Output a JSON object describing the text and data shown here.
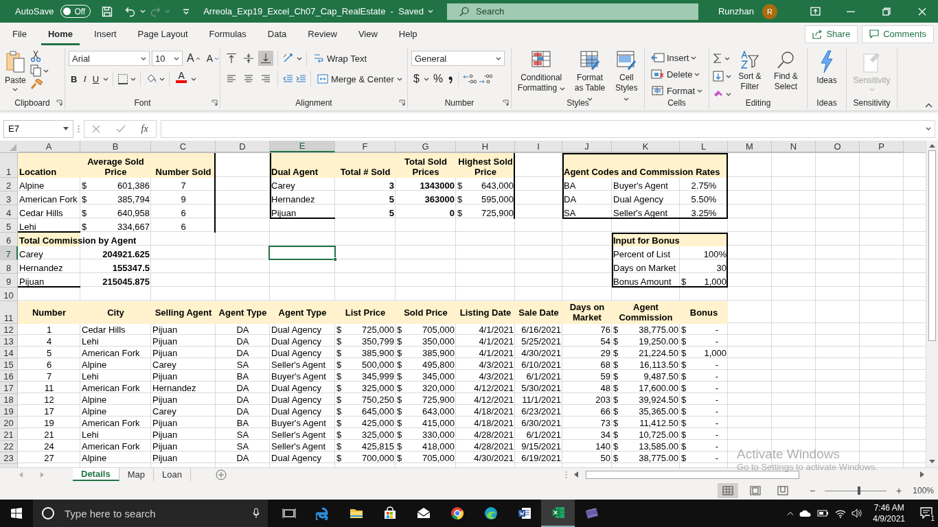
{
  "title_bar": {
    "autosave_label": "AutoSave",
    "autosave_on": false,
    "autosave_state": "Off",
    "document_title": "Arreola_Exp19_Excel_Ch07_Cap_RealEstate  -  Saved",
    "search_placeholder": "Search",
    "user_name": "Runzhan",
    "user_initial": "R"
  },
  "ribbon": {
    "tabs": [
      {
        "label": "File",
        "selected": false
      },
      {
        "label": "Home",
        "selected": true
      },
      {
        "label": "Insert",
        "selected": false
      },
      {
        "label": "Page Layout",
        "selected": false
      },
      {
        "label": "Formulas",
        "selected": false
      },
      {
        "label": "Data",
        "selected": false
      },
      {
        "label": "Review",
        "selected": false
      },
      {
        "label": "View",
        "selected": false
      },
      {
        "label": "Help",
        "selected": false
      }
    ],
    "share": "Share",
    "comments": "Comments",
    "groups": [
      {
        "kind": "clipboard",
        "label": "Clipboard",
        "paste": "Paste"
      },
      {
        "kind": "font",
        "label": "Font",
        "font_name": "Arial",
        "font_size": "10",
        "grow": "A",
        "shrink": "A",
        "bold": "B",
        "italic": "I",
        "underline": "U",
        "font_color": "A"
      },
      {
        "kind": "alignment",
        "label": "Alignment",
        "vertical_align": [
          {
            "selected": false
          },
          {
            "selected": false
          },
          {
            "selected": true
          }
        ],
        "horizontal_align": [
          {
            "selected": false
          },
          {
            "selected": false
          },
          {
            "selected": false
          }
        ],
        "wrap_text": "Wrap Text",
        "merge": "Merge & Center"
      },
      {
        "kind": "number",
        "label": "Number",
        "format": "General",
        "currency": "$",
        "percent": "%"
      },
      {
        "kind": "styles",
        "label": "Styles",
        "buttons": [
          "Conditional Formatting",
          "Format as Table",
          "Cell Styles"
        ]
      },
      {
        "kind": "cells",
        "label": "Cells",
        "buttons": [
          "Insert",
          "Delete",
          "Format"
        ]
      },
      {
        "kind": "editing",
        "label": "Editing",
        "buttons": [
          "Sort & Filter",
          "Find & Select"
        ]
      },
      {
        "kind": "ideas",
        "label": "Ideas",
        "button": "Ideas"
      },
      {
        "kind": "sensitivity",
        "label": "Sensitivity",
        "button": "Sensitivity",
        "disabled": true
      }
    ]
  },
  "formula_bar": {
    "name_box": "E7",
    "function_label": "fx"
  },
  "sheet": {
    "columns": [
      {
        "label": "A",
        "selected": false
      },
      {
        "label": "B",
        "selected": false
      },
      {
        "label": "C",
        "selected": false
      },
      {
        "label": "D",
        "selected": false
      },
      {
        "label": "E",
        "selected": true
      },
      {
        "label": "F",
        "selected": false
      },
      {
        "label": "G",
        "selected": false
      },
      {
        "label": "H",
        "selected": false
      },
      {
        "label": "I",
        "selected": false
      },
      {
        "label": "J",
        "selected": false
      },
      {
        "label": "K",
        "selected": false
      },
      {
        "label": "L",
        "selected": false
      },
      {
        "label": "M",
        "selected": false
      },
      {
        "label": "N",
        "selected": false
      },
      {
        "label": "O",
        "selected": false
      },
      {
        "label": "P",
        "selected": false
      }
    ],
    "rows": [
      {
        "label": "1",
        "selected": false,
        "kind": "tall",
        "cells": [
          {
            "kind": "heading-left",
            "text": "Location"
          },
          {
            "kind": "heading",
            "text": "Average Sold Price"
          },
          {
            "kind": "heading",
            "text": "Number Sold"
          },
          {
            "kind": "blank"
          },
          {
            "kind": "heading-left",
            "text": "Dual Agent"
          },
          {
            "kind": "heading",
            "text": "Total # Sold"
          },
          {
            "kind": "heading",
            "text": "Total Sold Prices"
          },
          {
            "kind": "heading",
            "text": "Highest Sold Price"
          },
          {
            "kind": "blank"
          },
          {
            "kind": "heading-left",
            "text": "Agent Codes and Commission Rates"
          },
          {
            "kind": "fill"
          },
          {
            "kind": "fill"
          }
        ]
      },
      {
        "label": "2",
        "selected": false,
        "kind": "normal",
        "cells": [
          {
            "kind": "text",
            "text": "Alpine"
          },
          {
            "kind": "money",
            "symbol": "$",
            "text": "601,386"
          },
          {
            "kind": "center",
            "text": "7"
          },
          {
            "kind": "blank"
          },
          {
            "kind": "text",
            "text": "Carey"
          },
          {
            "kind": "bold-num",
            "text": "3"
          },
          {
            "kind": "bold-num",
            "text": "1343000"
          },
          {
            "kind": "money",
            "symbol": "$",
            "text": "643,000"
          },
          {
            "kind": "blank"
          },
          {
            "kind": "text",
            "text": "BA"
          },
          {
            "kind": "text",
            "text": "Buyer's Agent"
          },
          {
            "kind": "center",
            "text": "2.75%"
          }
        ]
      },
      {
        "label": "3",
        "selected": false,
        "kind": "normal",
        "cells": [
          {
            "kind": "text",
            "text": "American Fork"
          },
          {
            "kind": "money",
            "symbol": "$",
            "text": "385,794"
          },
          {
            "kind": "center",
            "text": "9"
          },
          {
            "kind": "blank"
          },
          {
            "kind": "text",
            "text": "Hernandez"
          },
          {
            "kind": "bold-num",
            "text": "5"
          },
          {
            "kind": "bold-num",
            "text": "363000"
          },
          {
            "kind": "money",
            "symbol": "$",
            "text": "595,000"
          },
          {
            "kind": "blank"
          },
          {
            "kind": "text",
            "text": "DA"
          },
          {
            "kind": "text",
            "text": "Dual Agency"
          },
          {
            "kind": "center",
            "text": "5.50%"
          }
        ]
      },
      {
        "label": "4",
        "selected": false,
        "kind": "normal",
        "cells": [
          {
            "kind": "text",
            "text": "Cedar Hills"
          },
          {
            "kind": "money",
            "symbol": "$",
            "text": "640,958"
          },
          {
            "kind": "center",
            "text": "6"
          },
          {
            "kind": "blank"
          },
          {
            "kind": "text",
            "text": "Pijuan"
          },
          {
            "kind": "bold-num",
            "text": "5"
          },
          {
            "kind": "bold-num",
            "text": "0"
          },
          {
            "kind": "money",
            "symbol": "$",
            "text": "725,900"
          },
          {
            "kind": "blank"
          },
          {
            "kind": "text",
            "text": "SA"
          },
          {
            "kind": "text",
            "text": "Seller's Agent"
          },
          {
            "kind": "center",
            "text": "3.25%"
          }
        ]
      },
      {
        "label": "5",
        "selected": false,
        "kind": "normal",
        "cells": [
          {
            "kind": "text",
            "text": "Lehi"
          },
          {
            "kind": "money",
            "symbol": "$",
            "text": "334,667"
          },
          {
            "kind": "center",
            "text": "6"
          }
        ]
      },
      {
        "label": "6",
        "selected": false,
        "kind": "normal",
        "cells": [
          {
            "kind": "title",
            "text": "Total Commission by Agent"
          },
          {
            "kind": "blank"
          },
          {
            "kind": "blank"
          },
          {
            "kind": "blank"
          },
          {
            "kind": "blank"
          },
          {
            "kind": "blank"
          },
          {
            "kind": "blank"
          },
          {
            "kind": "blank"
          },
          {
            "kind": "blank"
          },
          {
            "kind": "blank"
          },
          {
            "kind": "title",
            "text": "Input for Bonus"
          },
          {
            "kind": "fill"
          }
        ]
      },
      {
        "label": "7",
        "selected": true,
        "kind": "normal",
        "cells": [
          {
            "kind": "text",
            "text": "Carey"
          },
          {
            "kind": "bold-num",
            "text": "204921.625"
          },
          {
            "kind": "blank"
          },
          {
            "kind": "blank"
          },
          {
            "kind": "blank"
          },
          {
            "kind": "blank"
          },
          {
            "kind": "blank"
          },
          {
            "kind": "blank"
          },
          {
            "kind": "blank"
          },
          {
            "kind": "blank"
          },
          {
            "kind": "text",
            "text": "Percent of List"
          },
          {
            "kind": "num",
            "text": "100%"
          }
        ]
      },
      {
        "label": "8",
        "selected": false,
        "kind": "normal",
        "cells": [
          {
            "kind": "text",
            "text": "Hernandez"
          },
          {
            "kind": "bold-num",
            "text": "155347.5"
          },
          {
            "kind": "blank"
          },
          {
            "kind": "blank"
          },
          {
            "kind": "blank"
          },
          {
            "kind": "blank"
          },
          {
            "kind": "blank"
          },
          {
            "kind": "blank"
          },
          {
            "kind": "blank"
          },
          {
            "kind": "blank"
          },
          {
            "kind": "text",
            "text": "Days on Market"
          },
          {
            "kind": "num",
            "text": "30"
          }
        ]
      },
      {
        "label": "9",
        "selected": false,
        "kind": "normal",
        "cells": [
          {
            "kind": "text",
            "text": "Pijuan"
          },
          {
            "kind": "bold-num",
            "text": "215045.875"
          },
          {
            "kind": "blank"
          },
          {
            "kind": "blank"
          },
          {
            "kind": "blank"
          },
          {
            "kind": "blank"
          },
          {
            "kind": "blank"
          },
          {
            "kind": "blank"
          },
          {
            "kind": "blank"
          },
          {
            "kind": "blank"
          },
          {
            "kind": "text",
            "text": "Bonus Amount"
          },
          {
            "kind": "money",
            "symbol": "$",
            "text": "1,000"
          }
        ]
      },
      {
        "label": "10",
        "selected": false,
        "kind": "normal"
      },
      {
        "label": "11",
        "selected": false,
        "kind": "header",
        "cells": [
          {
            "kind": "heading",
            "text": "Number"
          },
          {
            "kind": "heading",
            "text": "City"
          },
          {
            "kind": "heading",
            "text": "Selling Agent"
          },
          {
            "kind": "heading",
            "text": "Agent Type"
          },
          {
            "kind": "heading",
            "text": "Agent Type"
          },
          {
            "kind": "heading",
            "text": "List Price"
          },
          {
            "kind": "heading",
            "text": "Sold Price"
          },
          {
            "kind": "heading",
            "text": "Listing Date"
          },
          {
            "kind": "heading",
            "text": "Sale Date"
          },
          {
            "kind": "heading",
            "text": "Days on Market"
          },
          {
            "kind": "heading",
            "text": "Agent Commission"
          },
          {
            "kind": "heading",
            "text": "Bonus"
          }
        ]
      },
      {
        "label": "12",
        "selected": false,
        "kind": "compact",
        "cells": [
          {
            "kind": "center",
            "text": "1"
          },
          {
            "kind": "text",
            "text": "Cedar Hills"
          },
          {
            "kind": "text",
            "text": "Pijuan"
          },
          {
            "kind": "center",
            "text": "DA"
          },
          {
            "kind": "text",
            "text": "Dual Agency"
          },
          {
            "kind": "money",
            "symbol": "$",
            "text": "725,000"
          },
          {
            "kind": "money",
            "symbol": "$",
            "text": "705,000"
          },
          {
            "kind": "num",
            "text": "4/1/2021"
          },
          {
            "kind": "num",
            "text": "6/16/2021"
          },
          {
            "kind": "num",
            "text": "76"
          },
          {
            "kind": "money",
            "symbol": "$",
            "text": "38,775.00"
          },
          {
            "kind": "money-dash",
            "symbol": "$",
            "text": "-"
          }
        ]
      },
      {
        "label": "13",
        "selected": false,
        "kind": "compact",
        "cells": [
          {
            "kind": "center",
            "text": "4"
          },
          {
            "kind": "text",
            "text": "Lehi"
          },
          {
            "kind": "text",
            "text": "Pijuan"
          },
          {
            "kind": "center",
            "text": "DA"
          },
          {
            "kind": "text",
            "text": "Dual Agency"
          },
          {
            "kind": "money",
            "symbol": "$",
            "text": "350,799"
          },
          {
            "kind": "money",
            "symbol": "$",
            "text": "350,000"
          },
          {
            "kind": "num",
            "text": "4/1/2021"
          },
          {
            "kind": "num",
            "text": "5/25/2021"
          },
          {
            "kind": "num",
            "text": "54"
          },
          {
            "kind": "money",
            "symbol": "$",
            "text": "19,250.00"
          },
          {
            "kind": "money-dash",
            "symbol": "$",
            "text": "-"
          }
        ]
      },
      {
        "label": "14",
        "selected": false,
        "kind": "compact",
        "cells": [
          {
            "kind": "center",
            "text": "5"
          },
          {
            "kind": "text",
            "text": "American Fork"
          },
          {
            "kind": "text",
            "text": "Pijuan"
          },
          {
            "kind": "center",
            "text": "DA"
          },
          {
            "kind": "text",
            "text": "Dual Agency"
          },
          {
            "kind": "money",
            "symbol": "$",
            "text": "385,900"
          },
          {
            "kind": "money",
            "symbol": "$",
            "text": "385,900"
          },
          {
            "kind": "num",
            "text": "4/1/2021"
          },
          {
            "kind": "num",
            "text": "4/30/2021"
          },
          {
            "kind": "num",
            "text": "29"
          },
          {
            "kind": "money",
            "symbol": "$",
            "text": "21,224.50"
          },
          {
            "kind": "money",
            "symbol": "$",
            "text": "1,000"
          }
        ]
      },
      {
        "label": "15",
        "selected": false,
        "kind": "compact",
        "cells": [
          {
            "kind": "center",
            "text": "6"
          },
          {
            "kind": "text",
            "text": "Alpine"
          },
          {
            "kind": "text",
            "text": "Carey"
          },
          {
            "kind": "center",
            "text": "SA"
          },
          {
            "kind": "text",
            "text": "Seller's Agent"
          },
          {
            "kind": "money",
            "symbol": "$",
            "text": "500,000"
          },
          {
            "kind": "money",
            "symbol": "$",
            "text": "495,800"
          },
          {
            "kind": "num",
            "text": "4/3/2021"
          },
          {
            "kind": "num",
            "text": "6/10/2021"
          },
          {
            "kind": "num",
            "text": "68"
          },
          {
            "kind": "money",
            "symbol": "$",
            "text": "16,113.50"
          },
          {
            "kind": "money-dash",
            "symbol": "$",
            "text": "-"
          }
        ]
      },
      {
        "label": "16",
        "selected": false,
        "kind": "compact",
        "cells": [
          {
            "kind": "center",
            "text": "7"
          },
          {
            "kind": "text",
            "text": "Lehi"
          },
          {
            "kind": "text",
            "text": "Pijuan"
          },
          {
            "kind": "center",
            "text": "BA"
          },
          {
            "kind": "text",
            "text": "Buyer's Agent"
          },
          {
            "kind": "money",
            "symbol": "$",
            "text": "345,999"
          },
          {
            "kind": "money",
            "symbol": "$",
            "text": "345,000"
          },
          {
            "kind": "num",
            "text": "4/3/2021"
          },
          {
            "kind": "num",
            "text": "6/1/2021"
          },
          {
            "kind": "num",
            "text": "59"
          },
          {
            "kind": "money",
            "symbol": "$",
            "text": "9,487.50"
          },
          {
            "kind": "money-dash",
            "symbol": "$",
            "text": "-"
          }
        ]
      },
      {
        "label": "17",
        "selected": false,
        "kind": "compact",
        "cells": [
          {
            "kind": "center",
            "text": "11"
          },
          {
            "kind": "text",
            "text": "American Fork"
          },
          {
            "kind": "text",
            "text": "Hernandez"
          },
          {
            "kind": "center",
            "text": "DA"
          },
          {
            "kind": "text",
            "text": "Dual Agency"
          },
          {
            "kind": "money",
            "symbol": "$",
            "text": "325,000"
          },
          {
            "kind": "money",
            "symbol": "$",
            "text": "320,000"
          },
          {
            "kind": "num",
            "text": "4/12/2021"
          },
          {
            "kind": "num",
            "text": "5/30/2021"
          },
          {
            "kind": "num",
            "text": "48"
          },
          {
            "kind": "money",
            "symbol": "$",
            "text": "17,600.00"
          },
          {
            "kind": "money-dash",
            "symbol": "$",
            "text": "-"
          }
        ]
      },
      {
        "label": "18",
        "selected": false,
        "kind": "compact",
        "cells": [
          {
            "kind": "center",
            "text": "12"
          },
          {
            "kind": "text",
            "text": "Alpine"
          },
          {
            "kind": "text",
            "text": "Pijuan"
          },
          {
            "kind": "center",
            "text": "DA"
          },
          {
            "kind": "text",
            "text": "Dual Agency"
          },
          {
            "kind": "money",
            "symbol": "$",
            "text": "750,250"
          },
          {
            "kind": "money",
            "symbol": "$",
            "text": "725,900"
          },
          {
            "kind": "num",
            "text": "4/12/2021"
          },
          {
            "kind": "num",
            "text": "11/1/2021"
          },
          {
            "kind": "num",
            "text": "203"
          },
          {
            "kind": "money",
            "symbol": "$",
            "text": "39,924.50"
          },
          {
            "kind": "money-dash",
            "symbol": "$",
            "text": "-"
          }
        ]
      },
      {
        "label": "19",
        "selected": false,
        "kind": "compact",
        "cells": [
          {
            "kind": "center",
            "text": "17"
          },
          {
            "kind": "text",
            "text": "Alpine"
          },
          {
            "kind": "text",
            "text": "Carey"
          },
          {
            "kind": "center",
            "text": "DA"
          },
          {
            "kind": "text",
            "text": "Dual Agency"
          },
          {
            "kind": "money",
            "symbol": "$",
            "text": "645,000"
          },
          {
            "kind": "money",
            "symbol": "$",
            "text": "643,000"
          },
          {
            "kind": "num",
            "text": "4/18/2021"
          },
          {
            "kind": "num",
            "text": "6/23/2021"
          },
          {
            "kind": "num",
            "text": "66"
          },
          {
            "kind": "money",
            "symbol": "$",
            "text": "35,365.00"
          },
          {
            "kind": "money-dash",
            "symbol": "$",
            "text": "-"
          }
        ]
      },
      {
        "label": "20",
        "selected": false,
        "kind": "compact",
        "cells": [
          {
            "kind": "center",
            "text": "19"
          },
          {
            "kind": "text",
            "text": "American Fork"
          },
          {
            "kind": "text",
            "text": "Pijuan"
          },
          {
            "kind": "center",
            "text": "BA"
          },
          {
            "kind": "text",
            "text": "Buyer's Agent"
          },
          {
            "kind": "money",
            "symbol": "$",
            "text": "425,000"
          },
          {
            "kind": "money",
            "symbol": "$",
            "text": "415,000"
          },
          {
            "kind": "num",
            "text": "4/18/2021"
          },
          {
            "kind": "num",
            "text": "6/30/2021"
          },
          {
            "kind": "num",
            "text": "73"
          },
          {
            "kind": "money",
            "symbol": "$",
            "text": "11,412.50"
          },
          {
            "kind": "money-dash",
            "symbol": "$",
            "text": "-"
          }
        ]
      },
      {
        "label": "21",
        "selected": false,
        "kind": "compact",
        "cells": [
          {
            "kind": "center",
            "text": "21"
          },
          {
            "kind": "text",
            "text": "Lehi"
          },
          {
            "kind": "text",
            "text": "Pijuan"
          },
          {
            "kind": "center",
            "text": "SA"
          },
          {
            "kind": "text",
            "text": "Seller's Agent"
          },
          {
            "kind": "money",
            "symbol": "$",
            "text": "325,000"
          },
          {
            "kind": "money",
            "symbol": "$",
            "text": "330,000"
          },
          {
            "kind": "num",
            "text": "4/28/2021"
          },
          {
            "kind": "num",
            "text": "6/1/2021"
          },
          {
            "kind": "num",
            "text": "34"
          },
          {
            "kind": "money",
            "symbol": "$",
            "text": "10,725.00"
          },
          {
            "kind": "money-dash",
            "symbol": "$",
            "text": "-"
          }
        ]
      },
      {
        "label": "22",
        "selected": false,
        "kind": "compact",
        "cells": [
          {
            "kind": "center",
            "text": "24"
          },
          {
            "kind": "text",
            "text": "American Fork"
          },
          {
            "kind": "text",
            "text": "Pijuan"
          },
          {
            "kind": "center",
            "text": "SA"
          },
          {
            "kind": "text",
            "text": "Seller's Agent"
          },
          {
            "kind": "money",
            "symbol": "$",
            "text": "425,815"
          },
          {
            "kind": "money",
            "symbol": "$",
            "text": "418,000"
          },
          {
            "kind": "num",
            "text": "4/28/2021"
          },
          {
            "kind": "num",
            "text": "9/15/2021"
          },
          {
            "kind": "num",
            "text": "140"
          },
          {
            "kind": "money",
            "symbol": "$",
            "text": "13,585.00"
          },
          {
            "kind": "money-dash",
            "symbol": "$",
            "text": "-"
          }
        ]
      },
      {
        "label": "23",
        "selected": false,
        "kind": "compact",
        "cells": [
          {
            "kind": "center",
            "text": "27"
          },
          {
            "kind": "text",
            "text": "Alpine"
          },
          {
            "kind": "text",
            "text": "Pijuan"
          },
          {
            "kind": "center",
            "text": "DA"
          },
          {
            "kind": "text",
            "text": "Dual Agency"
          },
          {
            "kind": "money",
            "symbol": "$",
            "text": "700,000"
          },
          {
            "kind": "money",
            "symbol": "$",
            "text": "705,000"
          },
          {
            "kind": "num",
            "text": "4/30/2021"
          },
          {
            "kind": "num",
            "text": "6/19/2021"
          },
          {
            "kind": "num",
            "text": "50"
          },
          {
            "kind": "money",
            "symbol": "$",
            "text": "38,775.00"
          },
          {
            "kind": "money-dash",
            "symbol": "$",
            "text": "-"
          }
        ]
      }
    ]
  },
  "sheet_tabs": {
    "tabs": [
      {
        "label": "Details",
        "selected": true
      },
      {
        "label": "Map",
        "selected": false
      },
      {
        "label": "Loan",
        "selected": false
      }
    ]
  },
  "status_bar": {
    "views": [
      {
        "kind": "normal",
        "selected": true
      },
      {
        "kind": "page-layout",
        "selected": false
      },
      {
        "kind": "page-break",
        "selected": false
      }
    ],
    "zoom_out": "−",
    "zoom_in": "+",
    "zoom": {
      "level": 0.55
    },
    "zoom_label": "100%"
  },
  "taskbar": {
    "search_placeholder": "Type here to search",
    "apps": [
      {
        "kind": "task-view",
        "active": false
      },
      {
        "kind": "browser-e",
        "active": false
      },
      {
        "kind": "folder",
        "active": false
      },
      {
        "kind": "store",
        "active": false
      },
      {
        "kind": "mail",
        "active": false
      },
      {
        "kind": "circle-browser",
        "active": false
      },
      {
        "kind": "wave-browser",
        "active": false
      },
      {
        "kind": "document",
        "active": false
      },
      {
        "kind": "spreadsheet",
        "active": true
      },
      {
        "kind": "film",
        "active": false
      }
    ],
    "time": "7:46 AM",
    "date": "4/9/2021",
    "notifications": "1"
  },
  "activation_notice": {
    "title": "Activate Windows",
    "message": "Go to Settings to activate Windows."
  }
}
